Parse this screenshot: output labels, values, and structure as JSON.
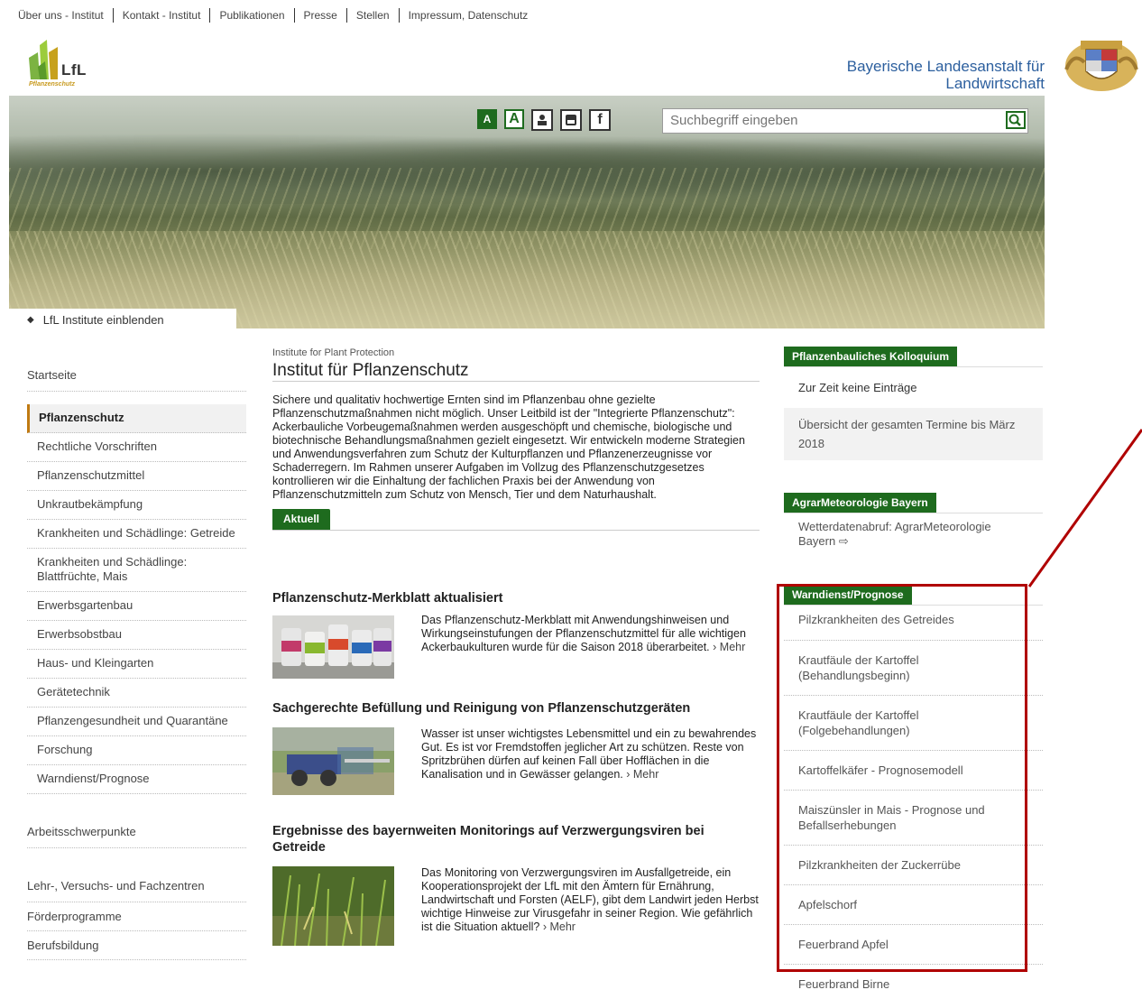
{
  "topnav": [
    "Über uns - Institut",
    "Kontakt - Institut",
    "Publikationen",
    "Presse",
    "Stellen",
    "Impressum, Datenschutz"
  ],
  "logo": {
    "text": "LfL",
    "sub": "Pflanzenschutz"
  },
  "org": {
    "line1": "Bayerische Landesanstalt für",
    "line2": "Landwirtschaft"
  },
  "tools": {
    "a_small": "A",
    "a_large": "A"
  },
  "search": {
    "placeholder": "Suchbegriff eingeben"
  },
  "institutes_toggle": "LfL Institute einblenden",
  "leftnav": {
    "home": "Startseite",
    "active": "Pflanzenschutz",
    "items": [
      "Rechtliche Vorschriften",
      "Pflanzenschutzmittel",
      "Unkrautbekämpfung",
      "Krankheiten und Schädlinge: Getreide",
      "Krankheiten und Schädlinge: Blattfrüchte, Mais",
      "Erwerbsgartenbau",
      "Erwerbsobstbau",
      "Haus- und Kleingarten",
      "Gerätetechnik",
      "Pflanzengesundheit und Quarantäne",
      "Forschung",
      "Warndienst/Prognose"
    ],
    "bottom": [
      "Arbeitsschwerpunkte",
      "Lehr-, Versuchs- und Fachzentren",
      "Förderprogramme",
      "Berufsbildung"
    ]
  },
  "main": {
    "kicker": "Institute for Plant Protection",
    "title": "Institut für Pflanzenschutz",
    "intro": "Sichere und qualitativ hochwertige Ernten sind im Pflanzenbau ohne gezielte Pflanzenschutzmaßnahmen nicht möglich. Unser Leitbild ist der \"Integrierte Pflanzenschutz\": Ackerbauliche Vorbeugemaßnahmen werden ausgeschöpft und chemische, biologische und biotechnische Behandlungsmaßnahmen gezielt eingesetzt. Wir entwickeln moderne Strategien und Anwendungsverfahren zum Schutz der Kulturpflanzen und Pflanzenerzeugnisse vor Schaderregern. Im Rahmen unserer Aufgaben im Vollzug des Pflanzenschutzgesetzes kontrollieren wir die Einhaltung der fachlichen Praxis bei der Anwendung von Pflanzenschutzmitteln zum Schutz von Mensch, Tier und dem Naturhaushalt.",
    "section": "Aktuell",
    "more": "Mehr",
    "news": [
      {
        "title": "Pflanzenschutz-Merkblatt aktualisiert",
        "text": "Das Pflanzenschutz-Merkblatt mit Anwendungshinweisen und Wirkungseinstufungen der Pflanzenschutzmittel für alle wichtigen Ackerbaukulturen wurde für die Saison 2018 überarbeitet."
      },
      {
        "title": "Sachgerechte Befüllung und Reinigung von Pflanzenschutzgeräten",
        "text": "Wasser ist unser wichtigstes Lebensmittel und ein zu bewahrendes Gut. Es ist vor Fremdstoffen jeglicher Art zu schützen. Reste von Spritzbrühen dürfen auf keinen Fall über Hofflächen in die Kanalisation und in Gewässer gelangen."
      },
      {
        "title": "Ergebnisse des bayernweiten Monitorings auf Verzwergungsviren bei Getreide",
        "text": "Das Monitoring von Verzwergungsviren im Ausfallgetreide, ein Kooperationsprojekt der LfL mit den Ämtern für Ernährung, Landwirtschaft und Forsten (AELF), gibt dem Landwirt jeden Herbst wichtige Hinweise zur Virusgefahr in seiner Region. Wie gefährlich ist die Situation aktuell?"
      }
    ]
  },
  "right": {
    "kolloquium": {
      "head": "Pflanzenbauliches Kolloquium",
      "item1": "Zur Zeit keine Einträge",
      "item2": "Übersicht der gesamten Termine bis März 2018"
    },
    "agrar": {
      "head": "AgrarMeteorologie Bayern",
      "item1": "Wetterdatenabruf: AgrarMeteorologie Bayern",
      "ext": "⇨"
    },
    "warn": {
      "head": "Warndienst/Prognose",
      "items": [
        "Pilzkrankheiten des Getreides",
        "Krautfäule der Kartoffel (Behandlungsbeginn)",
        "Krautfäule der Kartoffel (Folgebehandlungen)",
        "Kartoffelkäfer - Prognosemodell",
        "Maiszünsler in Mais - Prognose und Befallserhebungen",
        "Pilzkrankheiten der Zuckerrübe",
        "Apfelschorf",
        "Feuerbrand Apfel",
        "Feuerbrand Birne"
      ]
    }
  },
  "colors": {
    "green": "#1e6b1e",
    "highlight": "#b00000",
    "org_blue": "#2c5f9e"
  }
}
